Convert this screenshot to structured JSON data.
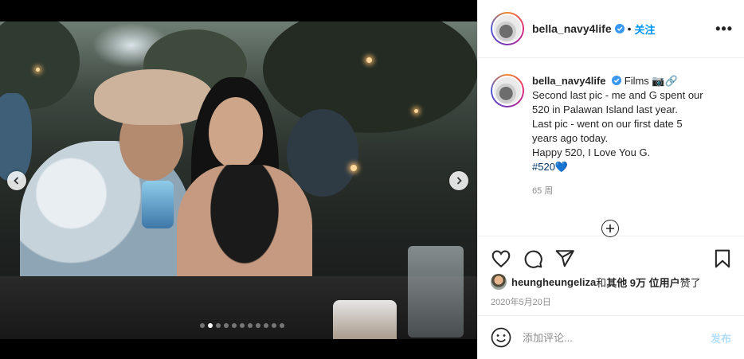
{
  "post": {
    "username": "bella_navy4life",
    "separator": "•",
    "follow_label": "关注",
    "more_label": "•••",
    "caption": {
      "username": "bella_navy4life",
      "location_prefix": "Films 📷🔗",
      "lines": [
        "Second last pic - me and G spent our",
        "520 in Palawan Island last year.",
        "Last pic - went on our first date 5",
        "years ago today.",
        "Happy 520, I Love You G."
      ],
      "hashtag": "#520",
      "hashtag_emoji": "💙"
    },
    "time_ago": "65 周",
    "likes": {
      "user": "heungheungeliza",
      "and": " 和 ",
      "others": "其他 9万 位用户",
      "suffix": " 赞了"
    },
    "date": "2020年5月20日",
    "comment_placeholder": "添加评论...",
    "post_button": "发布"
  },
  "carousel": {
    "dots_total": 11,
    "active_index": 1
  },
  "colors": {
    "accent": "#0095f6",
    "hashtag": "#00376b",
    "post_disabled": "#b2dffc",
    "muted": "#8e8e8e"
  },
  "icons": [
    "chevron-left-icon",
    "chevron-right-icon",
    "verified-icon",
    "more-icon",
    "heart-icon",
    "comment-icon",
    "share-icon",
    "bookmark-icon",
    "plus-circle-icon",
    "emoji-icon"
  ]
}
